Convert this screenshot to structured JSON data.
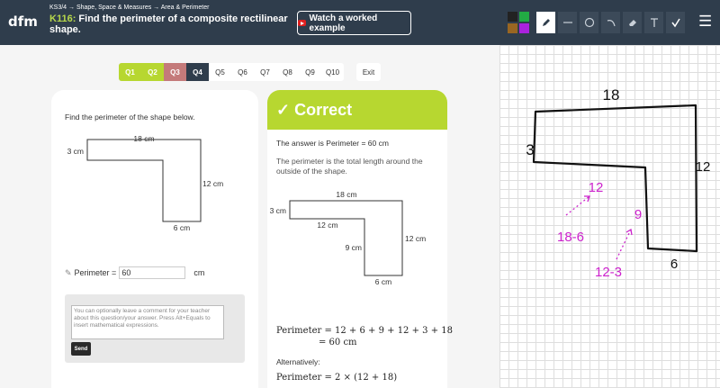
{
  "header": {
    "logo": "dfm",
    "breadcrumb": "KS3/4 → Shape, Space & Measures → Area & Perimeter",
    "code": "K116:",
    "title": "Find the perimeter of a composite rectilinear shape.",
    "watch_label": "Watch a worked example"
  },
  "colors": {
    "header_bg": "#2f3d4c",
    "accent_green": "#b7d730",
    "wrong_red": "#c47a7a",
    "current_dark": "#2f3d4c",
    "ink_magenta": "#cc22cc"
  },
  "palette": [
    "#222222",
    "#22aa44",
    "#996622",
    "#aa22dd"
  ],
  "tools": [
    "pen-icon",
    "line-icon",
    "circle-icon",
    "curve-icon",
    "eraser-icon",
    "text-icon",
    "check-icon"
  ],
  "nav": {
    "tabs": [
      {
        "label": "Q1",
        "state": "correct"
      },
      {
        "label": "Q2",
        "state": "correct"
      },
      {
        "label": "Q3",
        "state": "wrong"
      },
      {
        "label": "Q4",
        "state": "current"
      },
      {
        "label": "Q5",
        "state": "none"
      },
      {
        "label": "Q6",
        "state": "none"
      },
      {
        "label": "Q7",
        "state": "none"
      },
      {
        "label": "Q8",
        "state": "none"
      },
      {
        "label": "Q9",
        "state": "none"
      },
      {
        "label": "Q10",
        "state": "none"
      }
    ],
    "exit": "Exit"
  },
  "question": {
    "text": "Find the perimeter of the shape below.",
    "labels": {
      "top": "18 cm",
      "left": "3 cm",
      "right": "12 cm",
      "bottom": "6 cm"
    },
    "answer_label": "Perimeter =",
    "answer_value": "60",
    "answer_unit": "cm",
    "comment_placeholder": "You can optionally leave a comment for your teacher about this question/your answer. Press Alt+Equals to insert mathematical expressions.",
    "send_label": "Send"
  },
  "correct": {
    "heading": "✓ Correct",
    "answer_line": "The answer is Perimeter = 60 cm",
    "explanation": "The perimeter is the total length around the outside of the shape.",
    "diagram_labels": {
      "top": "18 cm",
      "left": "3 cm",
      "inner_top": "12 cm",
      "inner_left": "9 cm",
      "right": "12 cm",
      "bottom": "6 cm"
    },
    "working_1": "Perimeter = 12 + 6 + 9 + 12 + 3 + 18",
    "working_2": "= 60 cm",
    "alt_label": "Alternatively:",
    "working_3": "Perimeter = 2 × (12 + 18)"
  },
  "whiteboard": {
    "labels": [
      "18",
      "3",
      "12",
      "6",
      "12",
      "9",
      "18-6",
      "12-3"
    ]
  }
}
